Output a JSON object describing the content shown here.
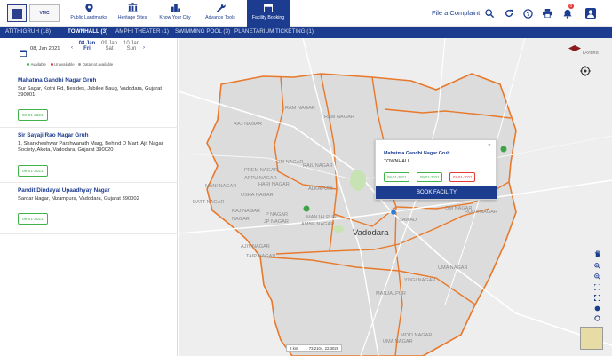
{
  "header": {
    "nav": [
      {
        "label": "Public Landmarks",
        "icon": "map-pin-icon"
      },
      {
        "label": "Heritage Sites",
        "icon": "temple-icon"
      },
      {
        "label": "Know Your City",
        "icon": "city-icon"
      },
      {
        "label": "Advance Tools",
        "icon": "wrench-icon"
      },
      {
        "label": "Facility Booking",
        "icon": "calendar-icon",
        "active": true
      }
    ],
    "complaint_label": "File a Complaint",
    "notification_count": "0"
  },
  "tabs": [
    {
      "label": "ATITHIGRUH (18)"
    },
    {
      "label": "TOWNHALL (3)",
      "active": true
    },
    {
      "label": "AMPHI THEATER (1)"
    },
    {
      "label": "SWIMMING POOL (3)"
    },
    {
      "label": "PLANETARIUM TICKETING (1)"
    }
  ],
  "datebar": {
    "selected_date": "08, Jan 2021",
    "days": [
      {
        "date": "08 Jan",
        "day": "Fri",
        "active": true
      },
      {
        "date": "09 Jan",
        "day": "Sat"
      },
      {
        "date": "10 Jan",
        "day": "Sun"
      }
    ]
  },
  "legend": [
    {
      "label": "Available",
      "color": "#41b34a"
    },
    {
      "label": "Unavailable",
      "color": "#e53935"
    },
    {
      "label": "Data not available",
      "color": "#9e9e9e"
    }
  ],
  "venues": [
    {
      "name": "Mahatma Gandhi Nagar Gruh",
      "address": "Sur Sagar, Kothi Rd, Besides, Jubilee Baug, Vadodara, Gujarat 390001",
      "chip": "08-01-2021"
    },
    {
      "name": "Sir Sayaji Rao Nagar Gruh",
      "address": "1, Shankheshwar Parshwanath Marg, Behind D Mart, Ajit Nagar Society, Akota, Vadodara, Gujarat 390020",
      "chip": "08-01-2021"
    },
    {
      "name": "Pandit Dindayal Upaadhyay Nagar",
      "address": "Sardar Nagar, Nizampura, Vadodara, Gujarat 390002",
      "chip": "08-01-2021"
    }
  ],
  "popup": {
    "title": "Mahatma Gandhi Nagar Gruh",
    "subtitle": "TOWNHALL",
    "chips": [
      {
        "label": "08-01-2021",
        "status": "available",
        "color": "#41b34a"
      },
      {
        "label": "09-01-2021",
        "status": "available",
        "color": "#41b34a"
      },
      {
        "label": "07-01-2021",
        "status": "unavailable",
        "color": "#e53935"
      }
    ],
    "button": "BOOK FACILITY",
    "close": "×"
  },
  "map": {
    "city": "Vadodara",
    "labels": [
      "RAM NAGAR",
      "RAM NAGAR",
      "RAJ NAGAR",
      "OM NAGAR",
      "PREM NAGAR",
      "APPU NAGAR",
      "HARI NAGAR",
      "RAIL NAGAR",
      "MANI NAGAR",
      "USHA NAGAR",
      "DATT NAGAR",
      "ALKAPURI",
      "RAJ NAGAR",
      "NAGAR",
      "P NAGAR",
      "JP NAGAR",
      "MANJALPUR",
      "AMBE NAGAR",
      "AJIT NAGAR",
      "TAIP NAGAR",
      "SAWAD",
      "OM NAGAR",
      "RUDA NAGAR",
      "UMA NAGAR",
      "YOGI NAGAR",
      "MANJALPUR",
      "MOTI NAGAR",
      "UMA NAGAR"
    ],
    "layers_label": "LAYERS",
    "scale": "2 km",
    "coordinates": "73.2104, 22.3026"
  }
}
